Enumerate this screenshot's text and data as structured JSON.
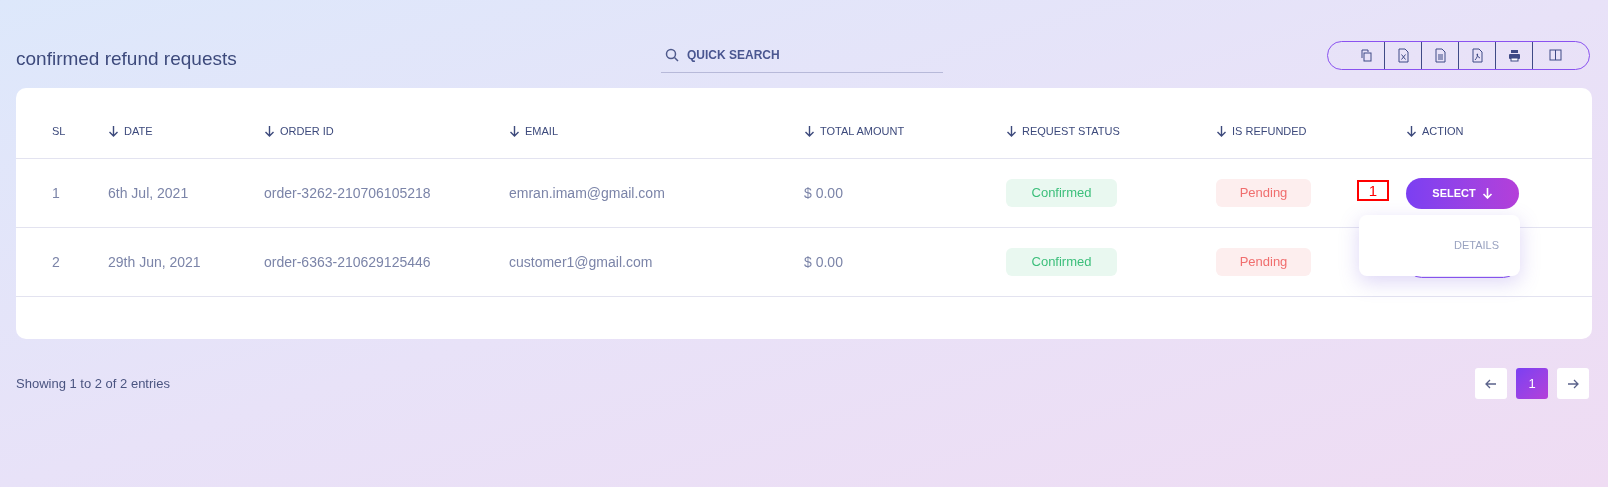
{
  "page_title": "confirmed refund requests",
  "search": {
    "placeholder": "QUICK SEARCH"
  },
  "toolbar": [
    {
      "kind": "copy"
    },
    {
      "kind": "excel"
    },
    {
      "kind": "csv"
    },
    {
      "kind": "pdf"
    },
    {
      "kind": "print"
    },
    {
      "kind": "columns"
    }
  ],
  "table": {
    "columns": [
      {
        "label": "SL",
        "sortable": false
      },
      {
        "label": "DATE",
        "sortable": true
      },
      {
        "label": "ORDER ID",
        "sortable": true
      },
      {
        "label": "EMAIL",
        "sortable": true
      },
      {
        "label": "TOTAL AMOUNT",
        "sortable": true
      },
      {
        "label": "REQUEST STATUS",
        "sortable": true
      },
      {
        "label": "IS REFUNDED",
        "sortable": true
      },
      {
        "label": "ACTION",
        "sortable": true
      }
    ],
    "rows": [
      {
        "sl": "1",
        "date": "6th Jul, 2021",
        "order_id": "order-3262-210706105218",
        "email": "emran.imam@gmail.com",
        "total": "$ 0.00",
        "request_status": {
          "label": "Confirmed",
          "kind": "success"
        },
        "refunded": {
          "label": "Pending",
          "kind": "danger"
        },
        "action": {
          "kind": "filled",
          "label": "SELECT"
        }
      },
      {
        "sl": "2",
        "date": "29th Jun, 2021",
        "order_id": "order-6363-210629125446",
        "email": "customer1@gmail.com",
        "total": "$ 0.00",
        "request_status": {
          "label": "Confirmed",
          "kind": "success"
        },
        "refunded": {
          "label": "Pending",
          "kind": "danger"
        },
        "action": {
          "kind": "outline"
        }
      }
    ]
  },
  "dropdown": {
    "items": [
      "DETAILS"
    ]
  },
  "annotation": {
    "label": "1"
  },
  "footer": {
    "info": "Showing 1 to 2 of 2 entries"
  },
  "pagination": {
    "pages": [
      {
        "label": "1",
        "selected": true
      }
    ]
  }
}
